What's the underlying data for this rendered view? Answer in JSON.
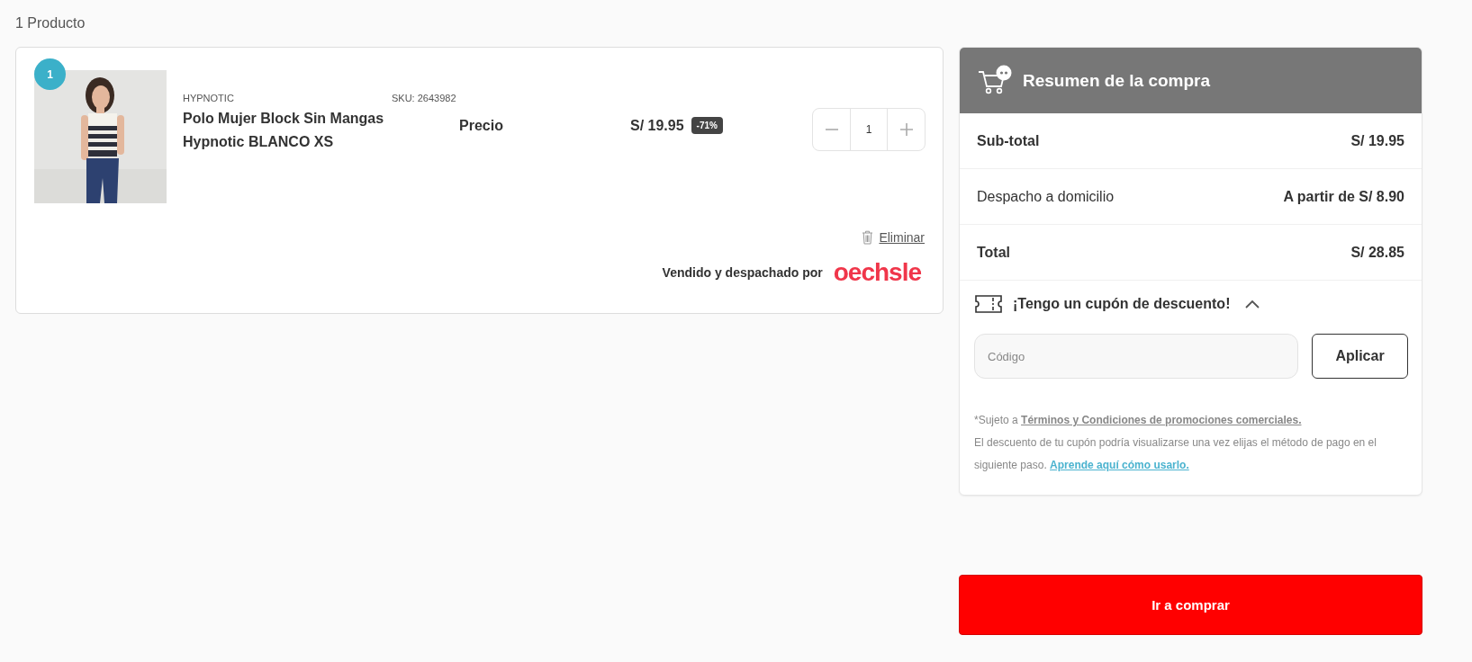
{
  "product_count": "1 Producto",
  "cart_items": [
    {
      "index": "1",
      "brand": "HYPNOTIC",
      "sku": "SKU: 2643982",
      "title": "Polo Mujer Block Sin Mangas Hypnotic BLANCO XS",
      "price_label": "Precio",
      "price": "S/ 19.95",
      "discount": "-71%",
      "quantity": "1",
      "remove": "Eliminar",
      "seller_label": "Vendido y despachado por",
      "seller": "oechsle"
    }
  ],
  "summary": {
    "title": "Resumen de la compra",
    "rows": [
      {
        "label": "Sub-total",
        "value": "S/ 19.95",
        "kind": "strong"
      },
      {
        "label": "Despacho a domicilio",
        "value": "A partir de S/ 8.90",
        "kind": "plain"
      },
      {
        "label": "Total",
        "value": "S/ 28.85",
        "kind": "strong"
      }
    ],
    "coupon": {
      "label": "¡Tengo un cupón de descuento!",
      "expanded": true,
      "placeholder": "Código",
      "button": "Aplicar"
    },
    "terms": {
      "prefix": "*Sujeto a",
      "terms_link": "Términos y Condiciones de promociones comerciales.",
      "note": "El descuento de tu cupón podría visualizarse una vez elijas el método de pago en el siguiente paso.",
      "help_link": "Aprende aquí cómo usarlo."
    }
  },
  "checkout_button": "Ir a comprar"
}
